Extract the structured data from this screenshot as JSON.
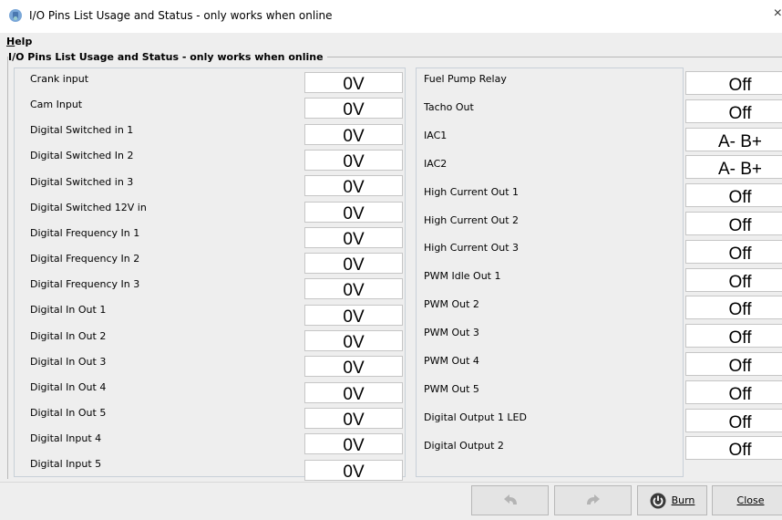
{
  "window": {
    "title": "I/O Pins List Usage and Status - only works when online",
    "close_glyph": "×"
  },
  "menu": {
    "help": "Help"
  },
  "group": {
    "title": "I/O Pins List Usage and Status - only works when online"
  },
  "left_rows": [
    {
      "label": "Crank input",
      "value": "0V"
    },
    {
      "label": "Cam Input",
      "value": "0V"
    },
    {
      "label": "Digital Switched in 1",
      "value": "0V"
    },
    {
      "label": "Digital Switched In 2",
      "value": "0V"
    },
    {
      "label": "Digital Switched in 3",
      "value": "0V"
    },
    {
      "label": "Digital Switched 12V in",
      "value": "0V"
    },
    {
      "label": "Digital Frequency In 1",
      "value": "0V"
    },
    {
      "label": "Digital Frequency In 2",
      "value": "0V"
    },
    {
      "label": "Digital Frequency In 3",
      "value": "0V"
    },
    {
      "label": "Digital In Out 1",
      "value": "0V"
    },
    {
      "label": "Digital In Out 2",
      "value": "0V"
    },
    {
      "label": "Digital In Out 3",
      "value": "0V"
    },
    {
      "label": "Digital In Out 4",
      "value": "0V"
    },
    {
      "label": "Digital In Out 5",
      "value": "0V"
    },
    {
      "label": "Digital Input 4",
      "value": "0V"
    },
    {
      "label": "Digital Input 5",
      "value": "0V"
    }
  ],
  "right_rows": [
    {
      "label": "Fuel Pump Relay",
      "value": "Off"
    },
    {
      "label": "Tacho Out",
      "value": "Off"
    },
    {
      "label": "IAC1",
      "value": "A- B+"
    },
    {
      "label": "IAC2",
      "value": "A- B+"
    },
    {
      "label": "High Current Out 1",
      "value": "Off"
    },
    {
      "label": "High Current Out 2",
      "value": "Off"
    },
    {
      "label": "High Current Out 3",
      "value": "Off"
    },
    {
      "label": "PWM Idle Out 1",
      "value": "Off"
    },
    {
      "label": "PWM Out 2",
      "value": "Off"
    },
    {
      "label": "PWM Out 3",
      "value": "Off"
    },
    {
      "label": "PWM Out 4",
      "value": "Off"
    },
    {
      "label": "PWM Out 5",
      "value": "Off"
    },
    {
      "label": "Digital Output 1 LED",
      "value": "Off"
    },
    {
      "label": "Digital Output 2",
      "value": "Off"
    }
  ],
  "buttons": {
    "burn": "Burn",
    "close": "Close"
  },
  "icons": {
    "app": "ecu-app-icon",
    "undo": "undo-icon",
    "redo": "redo-icon",
    "burn": "power-icon"
  }
}
